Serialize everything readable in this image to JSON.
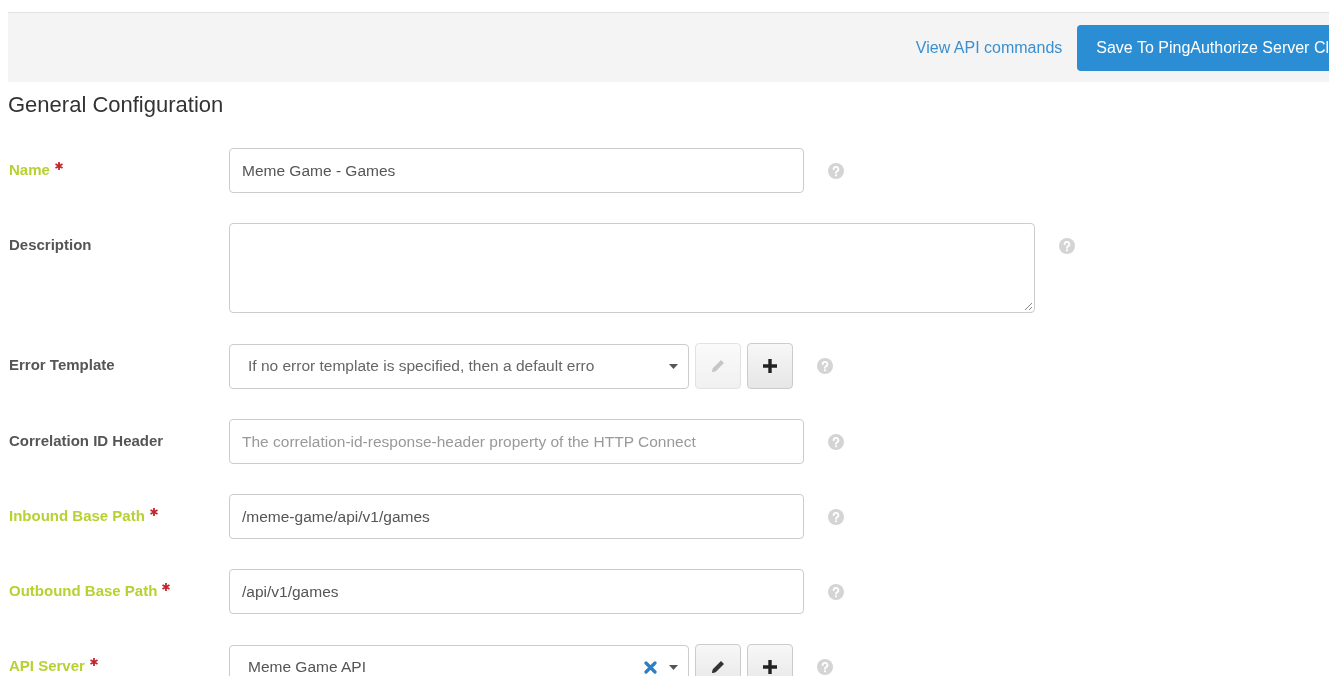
{
  "toolbar": {
    "link": "View API commands",
    "save_button": "Save To PingAuthorize Server Cl"
  },
  "section_title": "General Configuration",
  "fields": [
    {
      "kind": "text",
      "label": "Name",
      "required": true,
      "value": "Meme Game - Games"
    },
    {
      "kind": "textarea",
      "label": "Description",
      "required": false
    },
    {
      "kind": "select",
      "label": "Error Template",
      "required": false,
      "placeholder": "If no error template is specified, then a default erro",
      "clearable": false,
      "edit_disabled": true
    },
    {
      "kind": "text",
      "label": "Correlation ID Header",
      "required": false,
      "placeholder": "The correlation-id-response-header property of the HTTP Connect"
    },
    {
      "kind": "text",
      "label": "Inbound Base Path",
      "required": true,
      "value": "/meme-game/api/v1/games"
    },
    {
      "kind": "text",
      "label": "Outbound Base Path",
      "required": true,
      "value": "/api/v1/games"
    },
    {
      "kind": "select",
      "label": "API Server",
      "required": true,
      "value": "Meme Game API",
      "clearable": true,
      "edit_disabled": false
    }
  ]
}
